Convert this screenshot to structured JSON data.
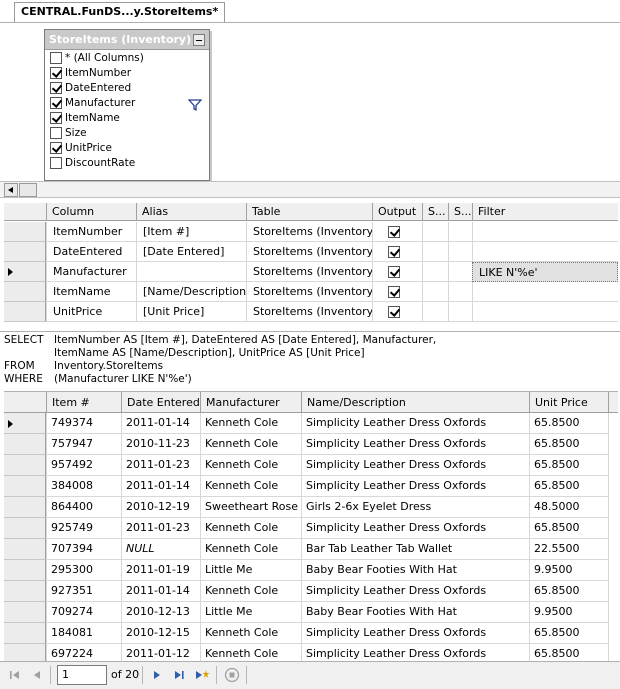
{
  "tab": {
    "title": "CENTRAL.FunDS...y.StoreItems*"
  },
  "diagram": {
    "table_title": "StoreItems (Inventory)",
    "columns": [
      {
        "label": "* (All Columns)",
        "checked": false
      },
      {
        "label": "ItemNumber",
        "checked": true
      },
      {
        "label": "DateEntered",
        "checked": true
      },
      {
        "label": "Manufacturer",
        "checked": true
      },
      {
        "label": "ItemName",
        "checked": true
      },
      {
        "label": "Size",
        "checked": false
      },
      {
        "label": "UnitPrice",
        "checked": true
      },
      {
        "label": "DiscountRate",
        "checked": false
      }
    ]
  },
  "criteria": {
    "headers": {
      "column": "Column",
      "alias": "Alias",
      "table": "Table",
      "output": "Output",
      "sort_type": "S...",
      "sort_order": "S...",
      "filter": "Filter"
    },
    "rows": [
      {
        "column": "ItemNumber",
        "alias": "[Item #]",
        "table": "StoreItems (Inventory)",
        "output": true,
        "filter": ""
      },
      {
        "column": "DateEntered",
        "alias": "[Date Entered]",
        "table": "StoreItems (Inventory)",
        "output": true,
        "filter": ""
      },
      {
        "column": "Manufacturer",
        "alias": "",
        "table": "StoreItems (Inventory)",
        "output": true,
        "filter": "LIKE N'%e'"
      },
      {
        "column": "ItemName",
        "alias": "[Name/Description]",
        "table": "StoreItems (Inventory)",
        "output": true,
        "filter": ""
      },
      {
        "column": "UnitPrice",
        "alias": "[Unit Price]",
        "table": "StoreItems (Inventory)",
        "output": true,
        "filter": ""
      }
    ]
  },
  "sql": {
    "select_kw": "SELECT",
    "select_1": "ItemNumber AS [Item #], DateEntered AS [Date Entered], Manufacturer,",
    "select_2": "ItemName AS [Name/Description], UnitPrice AS [Unit Price]",
    "from_kw": "FROM",
    "from_val": "Inventory.StoreItems",
    "where_kw": "WHERE",
    "where_val": "(Manufacturer LIKE N'%e')"
  },
  "results": {
    "headers": {
      "item": "Item #",
      "date": "Date Entered",
      "manufacturer": "Manufacturer",
      "name": "Name/Description",
      "price": "Unit Price"
    },
    "rows": [
      {
        "item": "749374",
        "date": "2011-01-14",
        "manufacturer": "Kenneth Cole",
        "name": "Simplicity Leather Dress Oxfords",
        "price": "65.8500"
      },
      {
        "item": "757947",
        "date": "2010-11-23",
        "manufacturer": "Kenneth Cole",
        "name": "Simplicity Leather Dress Oxfords",
        "price": "65.8500"
      },
      {
        "item": "957492",
        "date": "2011-01-23",
        "manufacturer": "Kenneth Cole",
        "name": "Simplicity Leather Dress Oxfords",
        "price": "65.8500"
      },
      {
        "item": "384008",
        "date": "2011-01-14",
        "manufacturer": "Kenneth Cole",
        "name": "Simplicity Leather Dress Oxfords",
        "price": "65.8500"
      },
      {
        "item": "864400",
        "date": "2010-12-19",
        "manufacturer": "Sweetheart Rose",
        "name": "Girls 2-6x Eyelet Dress",
        "price": "48.5000"
      },
      {
        "item": "925749",
        "date": "2011-01-23",
        "manufacturer": "Kenneth Cole",
        "name": "Simplicity Leather Dress Oxfords",
        "price": "65.8500"
      },
      {
        "item": "707394",
        "date": "NULL",
        "manufacturer": "Kenneth Cole",
        "name": "Bar Tab Leather Tab Wallet",
        "price": "22.5500"
      },
      {
        "item": "295300",
        "date": "2011-01-19",
        "manufacturer": "Little Me",
        "name": "Baby Bear Footies With Hat",
        "price": "9.9500"
      },
      {
        "item": "927351",
        "date": "2011-01-14",
        "manufacturer": "Kenneth Cole",
        "name": "Simplicity Leather Dress Oxfords",
        "price": "65.8500"
      },
      {
        "item": "709274",
        "date": "2010-12-13",
        "manufacturer": "Little Me",
        "name": "Baby Bear Footies With Hat",
        "price": "9.9500"
      },
      {
        "item": "184081",
        "date": "2010-12-15",
        "manufacturer": "Kenneth Cole",
        "name": "Simplicity Leather Dress Oxfords",
        "price": "65.8500"
      },
      {
        "item": "697224",
        "date": "2011-01-12",
        "manufacturer": "Kenneth Cole",
        "name": "Simplicity Leather Dress Oxfords",
        "price": "65.8500"
      }
    ]
  },
  "navigator": {
    "current_page": "1",
    "page_count_text": "of 20"
  },
  "colors": {
    "nav_icon": "#2a5fb0",
    "nav_disabled": "#a0a0a0",
    "new_row_star": "#e0a000"
  }
}
